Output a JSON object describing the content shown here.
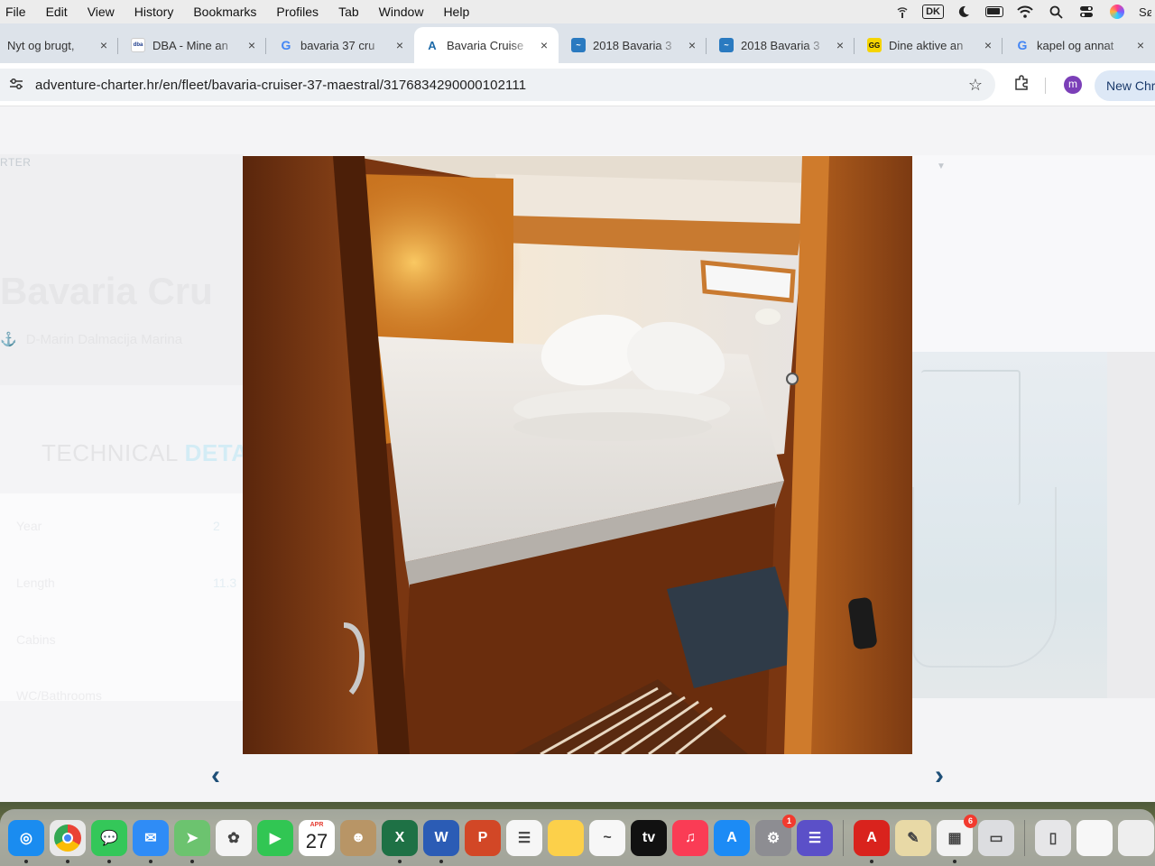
{
  "menubar": {
    "items": [
      "File",
      "Edit",
      "View",
      "History",
      "Bookmarks",
      "Profiles",
      "Tab",
      "Window",
      "Help"
    ],
    "keyboard_layout": "DK",
    "right_icons": [
      "airdrop-signal-icon",
      "keyboard-layout-icon",
      "focus-moon-icon",
      "battery-icon",
      "wifi-icon",
      "spotlight-search-icon",
      "control-center-icon",
      "siri-icon"
    ],
    "trailing_text": "Sø"
  },
  "tabs": [
    {
      "title": "Nyt og brugt,  ",
      "favicon": "",
      "active": false
    },
    {
      "title": "DBA - Mine an",
      "favicon": "dba",
      "active": false
    },
    {
      "title": "bavaria 37 cru",
      "favicon": "G",
      "active": false
    },
    {
      "title": "Bavaria Cruise",
      "favicon": "A",
      "active": true
    },
    {
      "title": "2018 Bavaria 3",
      "favicon": "~",
      "active": false
    },
    {
      "title": "2018 Bavaria 3",
      "favicon": "~",
      "active": false
    },
    {
      "title": "Dine aktive an",
      "favicon": "GG",
      "active": false
    },
    {
      "title": "kapel og annat",
      "favicon": "G",
      "active": false
    }
  ],
  "tab_close_glyph": "×",
  "toolbar": {
    "url": "adventure-charter.hr/en/fleet/bavaria-cruiser-37-maestral/3176834290000102111",
    "profile_initial": "m",
    "new_chrome_label": "New Chr"
  },
  "page": {
    "brand_ghost": "RTER",
    "title_ghost": "Bavaria Cru",
    "location_ghost": "D-Marin Dalmacija Marina",
    "tech_heading_plain": "TECHNICAL ",
    "tech_heading_accent": "DETA",
    "specs": [
      {
        "label": "Year",
        "value": "2"
      },
      {
        "label": "Length",
        "value": "11.3"
      },
      {
        "label": "Cabins",
        "value": ""
      },
      {
        "label": "WC/Bathrooms",
        "value": ""
      }
    ]
  },
  "lightbox": {
    "prev_glyph": "‹",
    "next_glyph": "›"
  },
  "dock": {
    "apps": [
      {
        "name": "Safari",
        "color": "#1a8cf0",
        "glyph": "◎",
        "running": true
      },
      {
        "name": "Chrome",
        "color": "#e9e9e9",
        "glyph": "",
        "running": true
      },
      {
        "name": "Messages",
        "color": "#34c759",
        "glyph": "💬",
        "running": true
      },
      {
        "name": "Mail",
        "color": "#2f8cf6",
        "glyph": "✉",
        "running": true
      },
      {
        "name": "Maps",
        "color": "#6cc36f",
        "glyph": "➤",
        "running": true
      },
      {
        "name": "Photos",
        "color": "#f4f4f4",
        "glyph": "✿",
        "running": false
      },
      {
        "name": "FaceTime",
        "color": "#31c653",
        "glyph": "▶",
        "running": false
      },
      {
        "name": "Calendar",
        "color": "#ffffff",
        "glyph": "",
        "running": false
      },
      {
        "name": "Contacts",
        "color": "#b89566",
        "glyph": "☻",
        "running": false
      },
      {
        "name": "Excel",
        "color": "#1e7145",
        "glyph": "X",
        "running": true
      },
      {
        "name": "Word",
        "color": "#2b5cb5",
        "glyph": "W",
        "running": true
      },
      {
        "name": "PowerPoint",
        "color": "#d24726",
        "glyph": "P",
        "running": false
      },
      {
        "name": "Reminders",
        "color": "#f6f6f6",
        "glyph": "☰",
        "running": false
      },
      {
        "name": "Notes",
        "color": "#fcd04a",
        "glyph": "",
        "running": false
      },
      {
        "name": "Freeform",
        "color": "#f7f7f7",
        "glyph": "~",
        "running": false
      },
      {
        "name": "Apple TV",
        "color": "#111111",
        "glyph": "tv",
        "running": false
      },
      {
        "name": "Music",
        "color": "#fa3c55",
        "glyph": "♫",
        "running": false
      },
      {
        "name": "App Store",
        "color": "#1c8bf5",
        "glyph": "A",
        "running": false
      },
      {
        "name": "System Settings",
        "color": "#8d8d92",
        "glyph": "⚙",
        "running": false,
        "badge": "1"
      },
      {
        "name": "Teams",
        "color": "#5b50c8",
        "glyph": "☰",
        "running": false
      }
    ],
    "apps_after_divider": [
      {
        "name": "Acrobat",
        "color": "#d9231d",
        "glyph": "A",
        "running": true
      },
      {
        "name": "Preview",
        "color": "#e8d9a6",
        "glyph": "✎",
        "running": false
      },
      {
        "name": "Microsoft Store",
        "color": "#f2f2f2",
        "glyph": "▦",
        "running": true,
        "badge": "6"
      },
      {
        "name": "Screen Sharing",
        "color": "#dcdde0",
        "glyph": "▭",
        "running": false
      }
    ],
    "recent_items": [
      {
        "name": "Phone Mirror",
        "color": "#e6e6e8",
        "glyph": "▯"
      },
      {
        "name": "Downloads",
        "color": "#f7f7f7",
        "glyph": ""
      },
      {
        "name": "Documents",
        "color": "#eeeeee",
        "glyph": ""
      }
    ],
    "calendar": {
      "month": "APR",
      "day": "27"
    }
  }
}
